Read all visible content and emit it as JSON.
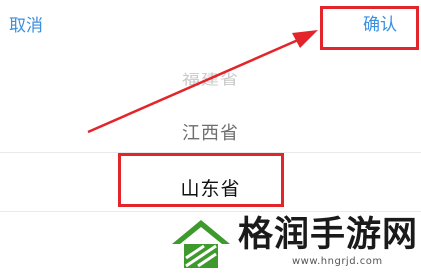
{
  "toolbar": {
    "cancel_label": "取消",
    "confirm_label": "确认"
  },
  "picker": {
    "items": [
      "福建省",
      "江西省",
      "山东省"
    ],
    "selected_index": 2
  },
  "watermark": {
    "brand": "格润手游网",
    "url": "www.hngrjd.com"
  },
  "colors": {
    "accent": "#3b8fe0",
    "highlight": "#e3242b",
    "logo_green": "#3e9a2c"
  }
}
